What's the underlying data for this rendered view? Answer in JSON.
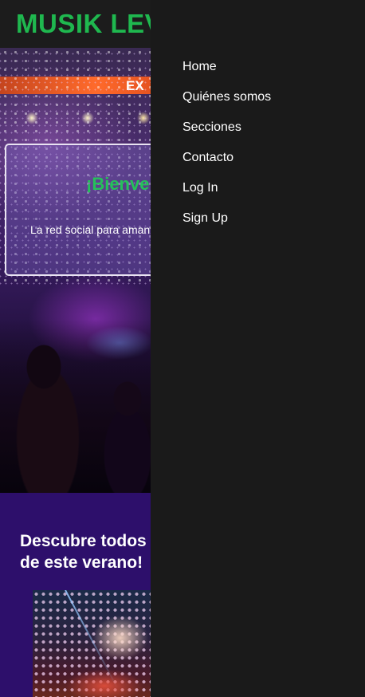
{
  "header": {
    "logo": "MUSIK LEVEL"
  },
  "hero": {
    "banner_text": "EX",
    "welcome_title": "¡Bienvenido a Musik Level!",
    "welcome_subtitle": "La red social para amantes de la música"
  },
  "section": {
    "heading": "Descubre todos los festivales de este verano!"
  },
  "nav": {
    "items": [
      "Home",
      "Quiénes somos",
      "Secciones",
      "Contacto",
      "Log In",
      "Sign Up"
    ]
  },
  "colors": {
    "brand_green": "#1fb84f",
    "header_bg": "#1c1c1c",
    "menu_bg": "#1a1a1a",
    "section_bg": "#2d0f6b"
  }
}
